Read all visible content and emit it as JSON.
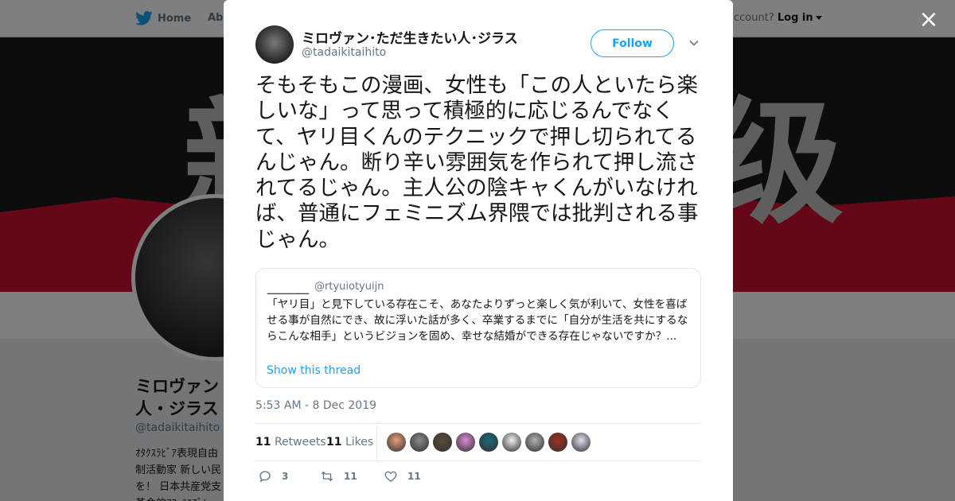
{
  "nav": {
    "home_label": "Home",
    "about_label": "Abo",
    "account_prompt": "ccount?",
    "login_label": "Log in"
  },
  "banner": {
    "kanji_left": "新",
    "kanji_right": "级"
  },
  "profile": {
    "name": "ミロヴァン・ただ生きたい人・ジラス",
    "name_visible": "ミロヴァン 人・ジラス",
    "handle": "@tadaikitaihito",
    "bio": "ｵﾀｸｽﾗﾋﾞｱ表現自由 制活動家 新しい民 を！ 日本共産党支 革命的ｱﾌｪﾐﾆｽﾞﾑ"
  },
  "close_icon": "×",
  "tweet": {
    "author_name": "ミロヴァン･ただ生きたい人･ジラス",
    "author_handle": "@tadaikitaihito",
    "follow_label": "Follow",
    "text": "そもそもこの漫画、女性も「この人といたら楽しいな」って思って積極的に応じるんでなくて、ヤリ目くんのテクニックで押し切られてるんじゃん。断り辛い雰囲気を作られて押し流されてるじゃん。主人公の陰キャくんがいなければ、普通にフェミニズム界隈では批判される事じゃん。",
    "quoted": {
      "name": "＿＿＿＿",
      "handle": "@rtyuiotyuijn",
      "text": "「ヤリ目」と見下している存在こそ、あなたよりずっと楽しく気が利いて、女性を喜ばせる事が自然にでき、故に浮いた話が多く、卒業するまでに「自分が生活を共にするならこんな相手」というビジョンを固め、幸せな結婚ができる存在じゃないですか？...",
      "thread_label": "Show this thread"
    },
    "timestamp": "5:53 AM - 8 Dec 2019",
    "retweets_count": "11",
    "retweets_label": "Retweets",
    "likes_count": "11",
    "likes_label": "Likes",
    "liker_colors": [
      "#e8a07a",
      "#8a8a8a",
      "#5a4a3a",
      "#d98ad6",
      "#1a6a7a",
      "#f0f0f0",
      "#b0b0b0",
      "#a0301e",
      "#e0e0f0"
    ],
    "actions": {
      "reply_count": "3",
      "retweet_count": "11",
      "like_count": "11"
    }
  },
  "colors": {
    "accent": "#1da1f2",
    "text": "#14171a",
    "muted": "#657786"
  }
}
